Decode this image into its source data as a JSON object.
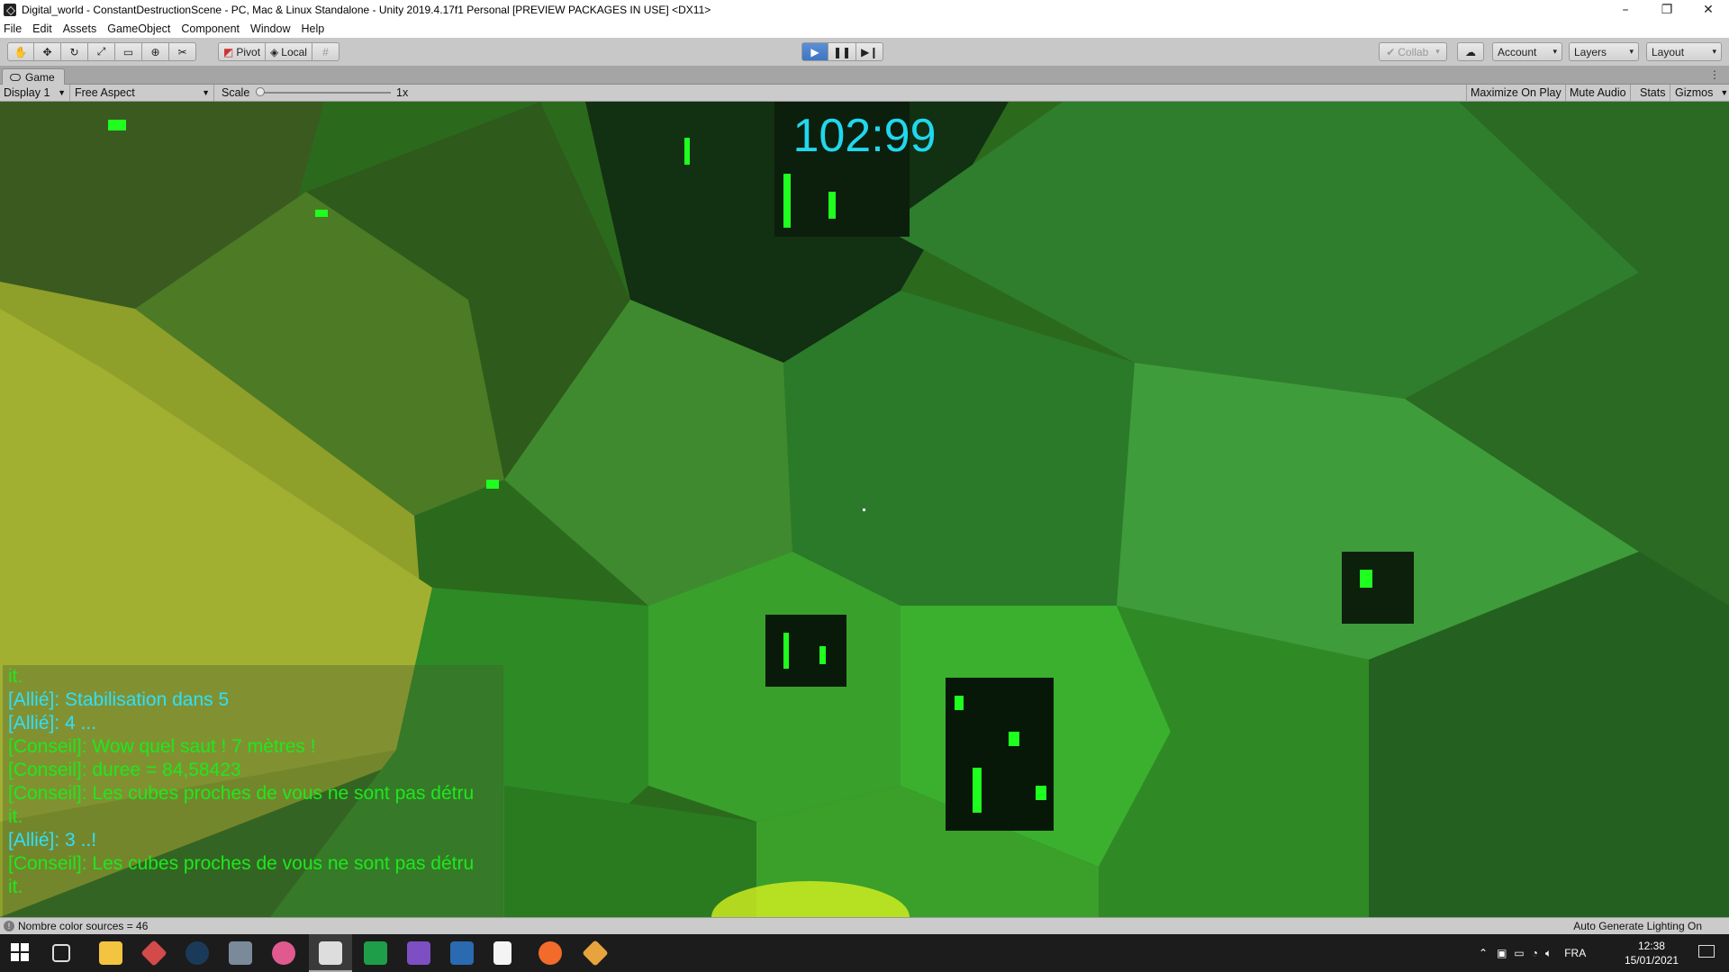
{
  "window": {
    "title": "Digital_world - ConstantDestructionScene - PC, Mac & Linux Standalone - Unity 2019.4.17f1 Personal [PREVIEW PACKAGES IN USE] <DX11>",
    "minimize": "–",
    "maximize": "❐",
    "close": "✕"
  },
  "menu": [
    "File",
    "Edit",
    "Assets",
    "GameObject",
    "Component",
    "Window",
    "Help"
  ],
  "toolbar": {
    "pivot_label": "Pivot",
    "local_label": "Local",
    "collab_label": "Collab",
    "account_label": "Account",
    "layers_label": "Layers",
    "layout_label": "Layout"
  },
  "game_tab": {
    "label": "Game",
    "menu": "⋮"
  },
  "game_view": {
    "display": "Display 1",
    "aspect": "Free Aspect",
    "scale_label": "Scale",
    "scale_value": "1x",
    "maximize_on_play": "Maximize On Play",
    "mute_audio": "Mute Audio",
    "stats": "Stats",
    "gizmos": "Gizmos"
  },
  "hud": {
    "timer": "102:99",
    "chat": [
      {
        "text": "it.",
        "type": "conseil"
      },
      {
        "text": "[Allié]: Stabilisation dans 5",
        "type": "allie"
      },
      {
        "text": "[Allié]: 4 ...",
        "type": "allie"
      },
      {
        "text": "[Conseil]: Wow quel saut ! 7 mètres !",
        "type": "conseil"
      },
      {
        "text": "[Conseil]: duree = 84,58423",
        "type": "conseil"
      },
      {
        "text": "[Conseil]: Les cubes proches de vous ne sont pas détru",
        "type": "conseil"
      },
      {
        "text": "it.",
        "type": "conseil"
      },
      {
        "text": "[Allié]: 3 ..!",
        "type": "allie"
      },
      {
        "text": "[Conseil]: Les cubes proches de vous ne sont pas détru",
        "type": "conseil"
      },
      {
        "text": "it.",
        "type": "conseil"
      }
    ]
  },
  "status": {
    "message": "Nombre color sources = 46",
    "right": "Auto Generate Lighting On"
  },
  "taskbar": {
    "language": "FRA",
    "time": "12:38",
    "date": "15/01/2021",
    "apps": [
      "windows-start-icon",
      "task-view-icon",
      "file-explorer-icon",
      "git-icon",
      "steam-icon",
      "app-icon",
      "osu-icon",
      "unity-icon",
      "pycharm-icon",
      "visual-studio-icon",
      "editor-icon",
      "notepad-icon",
      "firefox-icon",
      "git-kraken-icon"
    ]
  },
  "colors": {
    "timer": "#20d8ee",
    "allie": "#2de0ff",
    "conseil": "#1ee81e",
    "play_active": "#3f76c3"
  }
}
